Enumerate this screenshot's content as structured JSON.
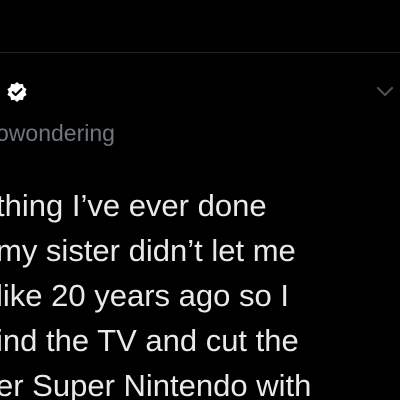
{
  "tweet": {
    "handle": "owondering",
    "verified_icon": "verified-badge-icon",
    "more_icon": "chevron-down-icon",
    "lines": [
      "thing I’ve ever done",
      "my sister didn’t let me",
      " like 20 years ago so I",
      "ind the TV and cut the",
      "er Super Nintendo with"
    ]
  },
  "colors": {
    "background": "#000000",
    "text_primary": "#e7e9ea",
    "text_secondary": "#71767b",
    "divider": "#1f2326"
  }
}
